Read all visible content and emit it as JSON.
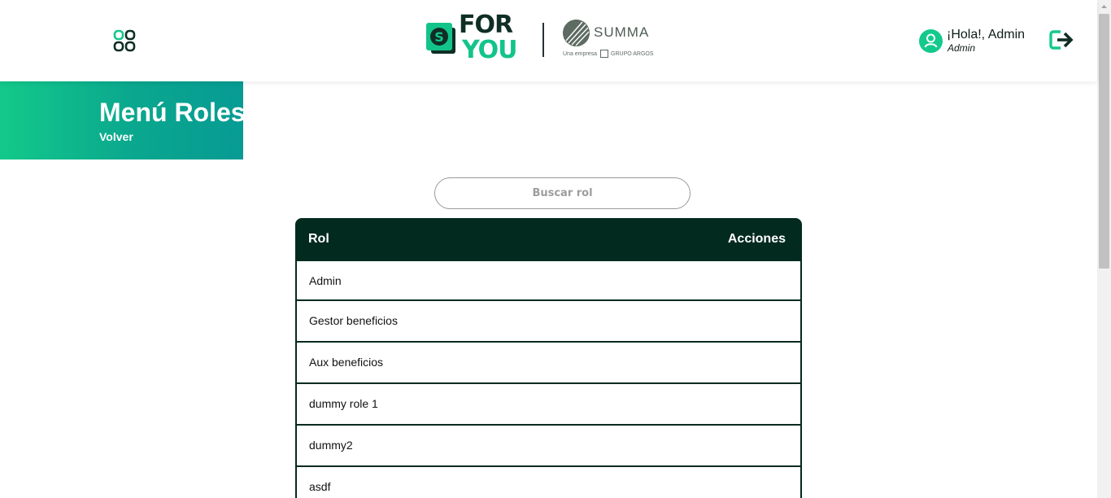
{
  "header": {
    "logo": {
      "s_letter": "S",
      "for": "FOR",
      "you": "YOU",
      "summa": "SUMMA",
      "summa_sub_left": "Una empresa",
      "summa_sub_right": "GRUPO ARGOS"
    },
    "user": {
      "greeting": "¡Hola!, Admin",
      "role": "Admin"
    },
    "icons": {
      "apps": "apps-grid-icon",
      "avatar": "user-icon",
      "logout": "logout-icon"
    }
  },
  "banner": {
    "title": "Menú Roles",
    "back_link": "Volver"
  },
  "search": {
    "placeholder": "Buscar rol",
    "value": ""
  },
  "table": {
    "columns": [
      "Rol",
      "Acciones"
    ],
    "rows": [
      "Admin",
      "Gestor beneficios",
      "Aux beneficios",
      "dummy role 1",
      "dummy2",
      "asdf"
    ]
  },
  "colors": {
    "brand_dark": "#032a1f",
    "brand_green": "#13c48a",
    "banner_gradient_start": "#13c98a",
    "banner_gradient_end": "#079b94"
  }
}
